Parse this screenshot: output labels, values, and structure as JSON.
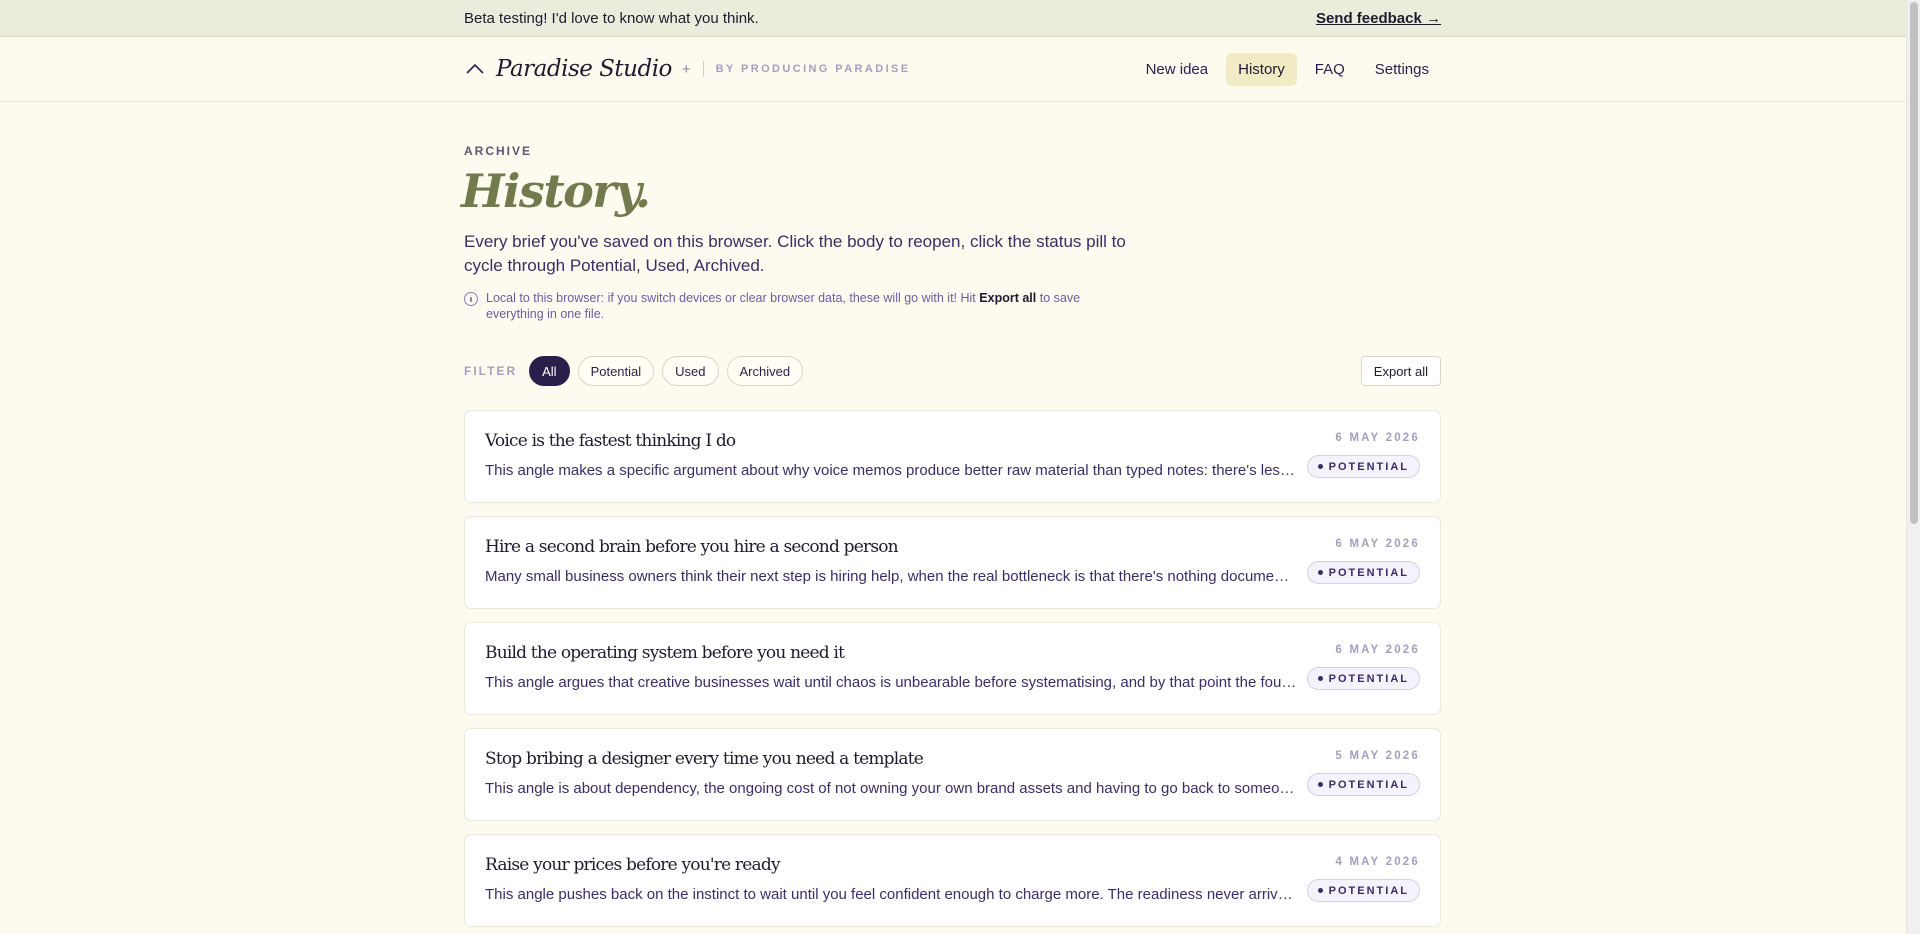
{
  "banner": {
    "message": "Beta testing! I'd love to know what you think.",
    "feedback_link": "Send feedback →"
  },
  "nav": {
    "brand_name": "Paradise Studio",
    "brand_plus": "+",
    "brand_by": "BY PRODUCING PARADISE",
    "links": [
      {
        "label": "New idea",
        "active": false
      },
      {
        "label": "History",
        "active": true
      },
      {
        "label": "FAQ",
        "active": false
      },
      {
        "label": "Settings",
        "active": false
      }
    ]
  },
  "page": {
    "eyebrow": "ARCHIVE",
    "title": "History.",
    "lead": "Every brief you've saved on this browser. Click the body to reopen, click the status pill to cycle through Potential, Used, Archived.",
    "note": {
      "prefix": "Local to this browser: if you switch devices or clear browser data, these will go with it! Hit",
      "bold": "Export all",
      "suffix": "to save everything in one file."
    }
  },
  "filter": {
    "label": "FILTER",
    "chips": [
      {
        "label": "All",
        "active": true
      },
      {
        "label": "Potential",
        "active": false
      },
      {
        "label": "Used",
        "active": false
      },
      {
        "label": "Archived",
        "active": false
      }
    ],
    "export_label": "Export all"
  },
  "briefs": [
    {
      "title": "Voice is the fastest thinking I do",
      "body": "This angle makes a specific argument about why voice memos produce better raw material than typed notes: there's less friction between the thought and the capture.",
      "date": "6 MAY 2026",
      "status": "POTENTIAL"
    },
    {
      "title": "Hire a second brain before you hire a second person",
      "body": "Many small business owners think their next step is hiring help, when the real bottleneck is that there's nothing documented to hand over.",
      "date": "6 MAY 2026",
      "status": "POTENTIAL"
    },
    {
      "title": "Build the operating system before you need it",
      "body": "This angle argues that creative businesses wait until chaos is unbearable before systematising, and by that point the founder is too stretched to do it well.",
      "date": "6 MAY 2026",
      "status": "POTENTIAL"
    },
    {
      "title": "Stop bribing a designer every time you need a template",
      "body": "This angle is about dependency, the ongoing cost of not owning your own brand assets and having to go back to someone else every time.",
      "date": "5 MAY 2026",
      "status": "POTENTIAL"
    },
    {
      "title": "Raise your prices before you're ready",
      "body": "This angle pushes back on the instinct to wait until you feel confident enough to charge more. The readiness never arrives on its own.",
      "date": "4 MAY 2026",
      "status": "POTENTIAL"
    }
  ]
}
